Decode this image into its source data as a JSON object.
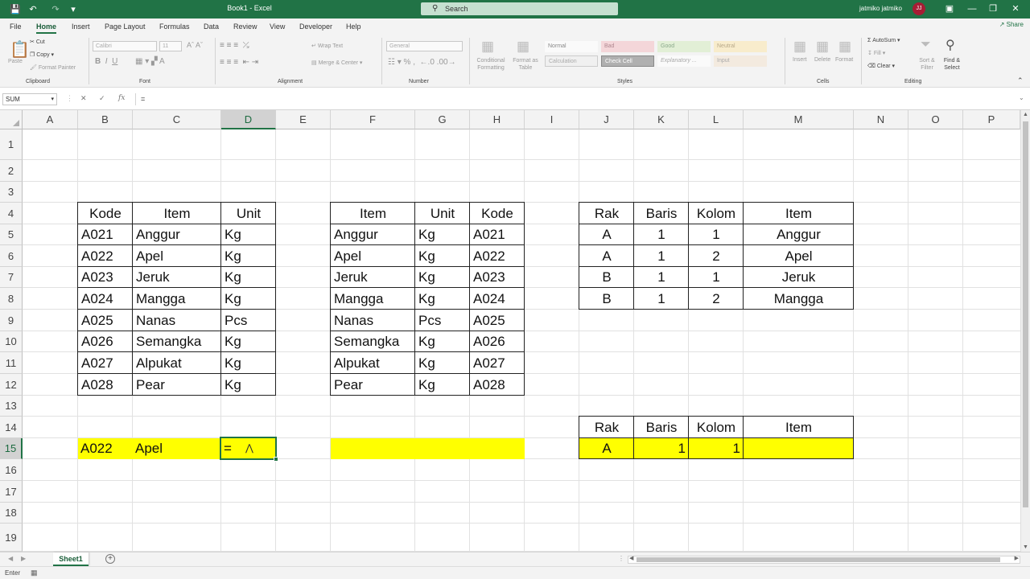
{
  "titlebar": {
    "doc_title": "Book1 - Excel",
    "search_placeholder": "Search",
    "user_name": "jatmiko jatmiko",
    "user_initials": "JJ"
  },
  "menu_tabs": [
    "File",
    "Home",
    "Insert",
    "Page Layout",
    "Formulas",
    "Data",
    "Review",
    "View",
    "Developer",
    "Help"
  ],
  "active_tab": "Home",
  "share_label": "Share",
  "ribbon": {
    "clipboard": {
      "paste": "Paste",
      "cut": "Cut",
      "copy": "Copy",
      "format_painter": "Format Painter",
      "label": "Clipboard"
    },
    "font": {
      "name": "Calibri",
      "size": "11",
      "label": "Font"
    },
    "alignment": {
      "wrap": "Wrap Text",
      "merge": "Merge & Center",
      "label": "Alignment"
    },
    "number": {
      "format": "General",
      "label": "Number"
    },
    "styles": {
      "conditional": "Conditional Formatting",
      "format_table": "Format as Table",
      "cells": [
        "Normal",
        "Bad",
        "Good",
        "Neutral",
        "Calculation",
        "Check Cell",
        "Explanatory ...",
        "Input"
      ],
      "label": "Styles"
    },
    "cells": {
      "insert": "Insert",
      "delete": "Delete",
      "format": "Format",
      "label": "Cells"
    },
    "editing": {
      "autosum": "AutoSum",
      "fill": "Fill",
      "clear": "Clear",
      "sort": "Sort & Filter",
      "find": "Find & Select",
      "label": "Editing"
    }
  },
  "formula_bar": {
    "name_box": "SUM",
    "formula": "=",
    "fx": "fx"
  },
  "columns": [
    "A",
    "B",
    "C",
    "D",
    "E",
    "F",
    "G",
    "H",
    "I",
    "J",
    "K",
    "L",
    "M",
    "N",
    "O",
    "P"
  ],
  "selected_column": "D",
  "rows": [
    "1",
    "2",
    "3",
    "4",
    "5",
    "6",
    "7",
    "8",
    "9",
    "10",
    "11",
    "12",
    "13",
    "14",
    "15",
    "16",
    "17",
    "18",
    "19"
  ],
  "selected_row": "15",
  "table1": {
    "headers": [
      "Kode",
      "Item",
      "Unit"
    ],
    "rows": [
      [
        "A021",
        "Anggur",
        "Kg"
      ],
      [
        "A022",
        "Apel",
        "Kg"
      ],
      [
        "A023",
        "Jeruk",
        "Kg"
      ],
      [
        "A024",
        "Mangga",
        "Kg"
      ],
      [
        "A025",
        "Nanas",
        "Pcs"
      ],
      [
        "A026",
        "Semangka",
        "Kg"
      ],
      [
        "A027",
        "Alpukat",
        "Kg"
      ],
      [
        "A028",
        "Pear",
        "Kg"
      ]
    ]
  },
  "table2": {
    "headers": [
      "Item",
      "Unit",
      "Kode"
    ],
    "rows": [
      [
        "Anggur",
        "Kg",
        "A021"
      ],
      [
        "Apel",
        "Kg",
        "A022"
      ],
      [
        "Jeruk",
        "Kg",
        "A023"
      ],
      [
        "Mangga",
        "Kg",
        "A024"
      ],
      [
        "Nanas",
        "Pcs",
        "A025"
      ],
      [
        "Semangka",
        "Kg",
        "A026"
      ],
      [
        "Alpukat",
        "Kg",
        "A027"
      ],
      [
        "Pear",
        "Kg",
        "A028"
      ]
    ]
  },
  "table3": {
    "headers": [
      "Rak",
      "Baris",
      "Kolom",
      "Item"
    ],
    "rows": [
      [
        "A",
        "1",
        "1",
        "Anggur"
      ],
      [
        "A",
        "1",
        "2",
        "Apel"
      ],
      [
        "B",
        "1",
        "1",
        "Jeruk"
      ],
      [
        "B",
        "1",
        "2",
        "Mangga"
      ]
    ]
  },
  "lookup1": {
    "kode": "A022",
    "item": "Apel",
    "unit_editing": "="
  },
  "lookup3": {
    "headers": [
      "Rak",
      "Baris",
      "Kolom",
      "Item"
    ],
    "values": [
      "A",
      "1",
      "1",
      ""
    ]
  },
  "sheet_tab": "Sheet1",
  "status": "Enter",
  "colors": {
    "excel_green": "#217346",
    "highlight": "#ffff00"
  }
}
